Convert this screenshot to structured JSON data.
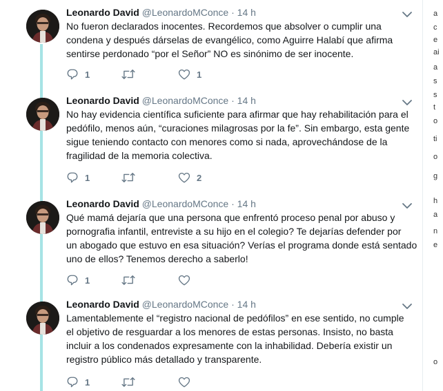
{
  "author": {
    "name": "Leonardo David",
    "handle": "@LeonardoMConce",
    "separator": "·"
  },
  "icons": {
    "reply": "reply-icon",
    "retweet": "retweet-icon",
    "like": "heart-icon",
    "more": "chevron-down-icon"
  },
  "colors": {
    "thread_line": "#a6e3e5",
    "icon": "#657786",
    "text": "#14171a"
  },
  "tweets": [
    {
      "time": "14 h",
      "lines": [
        "No fueron declarados inocentes. Recordemos que absolver o cumplir una",
        "condena y después dárselas de evangélico, como Aguirre Halabí que afirma",
        "sentirse perdonado “por el Señor” NO es sinónimo de ser inocente."
      ],
      "replies": "1",
      "retweets": "",
      "likes": "1"
    },
    {
      "time": "14 h",
      "lines": [
        "No hay evidencia científica suficiente para afirmar que hay rehabilitación para el",
        "pedófilo, menos aún, “curaciones milagrosas por la fe”. Sin embargo, esta gente",
        "sigue teniendo contacto con menores como si nada, aprovechándose de la",
        "fragilidad de la memoria colectiva."
      ],
      "replies": "1",
      "retweets": "",
      "likes": "2"
    },
    {
      "time": "14 h",
      "lines": [
        "Qué mamá dejaría que una persona que enfrentó proceso penal por abuso y",
        "pornografia infantil, entreviste a su hijo en el colegio? Te dejarías defender por",
        "un abogado que estuvo en esa situación? Verías el programa donde está sentado",
        "uno de ellos? Tenemos derecho a saberlo!"
      ],
      "replies": "1",
      "retweets": "",
      "likes": ""
    },
    {
      "time": "14 h",
      "lines": [
        "Lamentablemente el “registro nacional de pedófilos” en ese sentido, no cumple",
        "el objetivo de resguardar a los menores de estas personas. Insisto, no basta",
        "incluir a los condenados expresamente con la inhabilidad. Debería existir un",
        "registro público más detallado y transparente."
      ],
      "replies": "1",
      "retweets": "",
      "likes": ""
    }
  ],
  "edge_glyphs": [
    "a",
    "c",
    "e",
    "ai",
    "a",
    "s",
    "s",
    "t",
    "o",
    "ti",
    "o",
    "g",
    "h",
    "a",
    "n",
    "e",
    "o"
  ]
}
